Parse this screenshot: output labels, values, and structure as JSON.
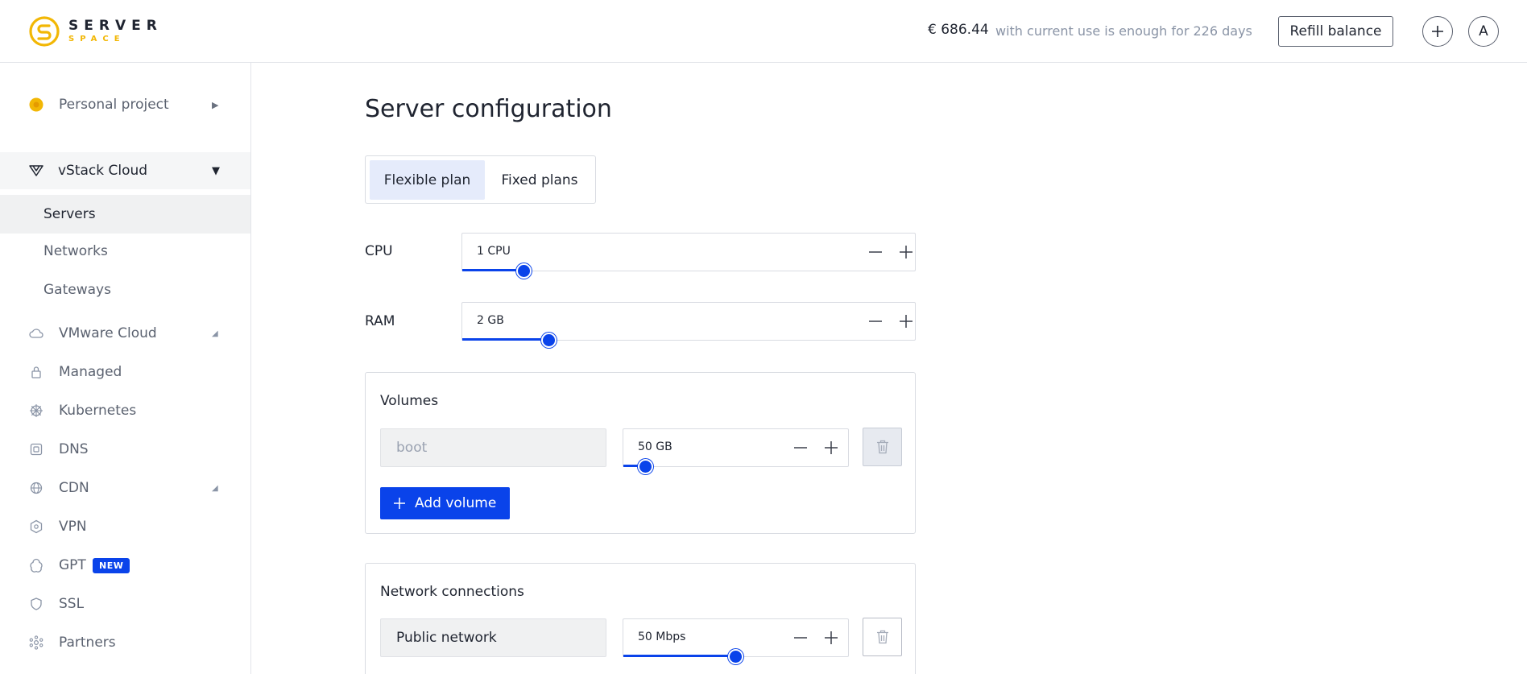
{
  "header": {
    "logo_top": "SERVER",
    "logo_bottom": "SPACE",
    "balance_amount": "€ 686.44",
    "balance_note": "with current use is enough for 226 days",
    "refill_label": "Refill balance",
    "add_label": "+",
    "avatar_letter": "A"
  },
  "sidebar": {
    "project": "Personal project",
    "section": "vStack Cloud",
    "sub_items": [
      "Servers",
      "Networks",
      "Gateways"
    ],
    "items": [
      {
        "label": "VMware Cloud",
        "icon": "cloud-icon"
      },
      {
        "label": "Managed",
        "icon": "lock-icon"
      },
      {
        "label": "Kubernetes",
        "icon": "helm-icon"
      },
      {
        "label": "DNS",
        "icon": "dns-icon"
      },
      {
        "label": "CDN",
        "icon": "globe-icon"
      },
      {
        "label": "VPN",
        "icon": "vpn-icon"
      },
      {
        "label": "GPT",
        "icon": "gpt-icon",
        "badge": "NEW"
      },
      {
        "label": "SSL",
        "icon": "shield-icon"
      },
      {
        "label": "Partners",
        "icon": "partners-icon"
      }
    ]
  },
  "main": {
    "title": "Server configuration",
    "tabs": [
      "Flexible plan",
      "Fixed plans"
    ],
    "cpu": {
      "label": "CPU",
      "value": "1  CPU",
      "level": 0.137
    },
    "ram": {
      "label": "RAM",
      "value": "2  GB",
      "level": 0.193
    },
    "volumes": {
      "title": "Volumes",
      "name": "boot",
      "size": "50  GB",
      "level": 0.1,
      "add_label": "Add volume"
    },
    "network": {
      "title": "Network connections",
      "name": "Public network",
      "speed": "50  Mbps",
      "level": 0.5
    }
  },
  "colors": {
    "accent": "#0a43ea",
    "logo": "#f2b705"
  }
}
